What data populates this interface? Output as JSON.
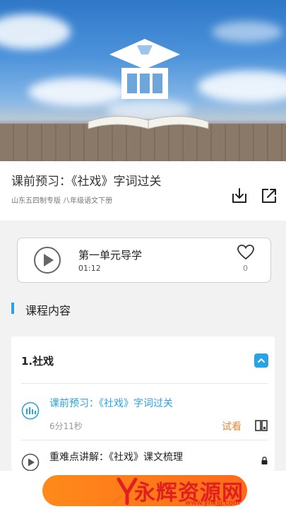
{
  "course": {
    "title": "课前预习：《社戏》字词过关",
    "subtitle": "山东五四制专版 八年级语文下册"
  },
  "featured": {
    "title": "第一单元导学",
    "duration": "01:12",
    "likes": "0"
  },
  "section": {
    "title": "课程内容"
  },
  "chapter": {
    "title": "1.社戏"
  },
  "lessons": [
    {
      "title": "课前预习：《社戏》字词过关",
      "duration": "6分11秒",
      "trial_label": "试看",
      "state": "playing"
    },
    {
      "title": "重难点讲解：《社戏》课文梳理",
      "state": "locked"
    }
  ],
  "watermark": {
    "text": "永辉资源网",
    "url": "www.yhkjjj.com"
  },
  "colors": {
    "accent": "#29a3e4",
    "trial": "#e78a3c",
    "buy": "#ff7a1a"
  },
  "icons": [
    "download-icon",
    "share-icon",
    "play-icon",
    "heart-icon",
    "chevron-up-icon",
    "audio-wave-icon",
    "book-icon",
    "lock-icon"
  ]
}
